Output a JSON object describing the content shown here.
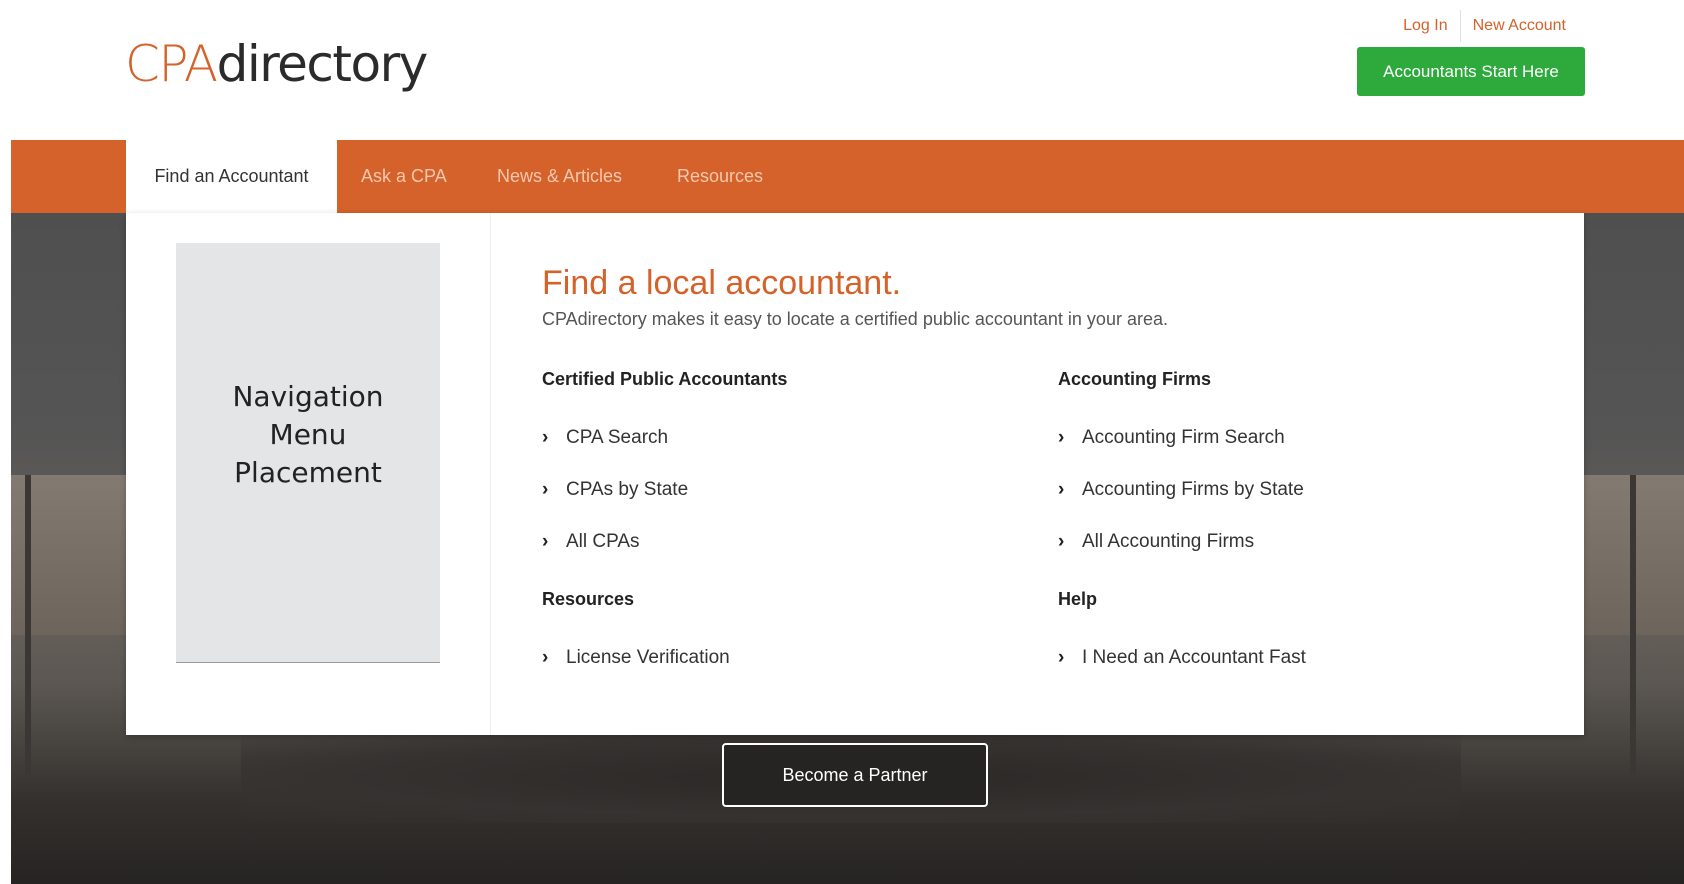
{
  "header": {
    "logo": {
      "part1": "CPA",
      "part2": "directory"
    },
    "login_label": "Log In",
    "new_account_label": "New Account",
    "cta_label": "Accountants Start Here"
  },
  "nav": {
    "tabs": [
      {
        "label": "Find an Accountant",
        "active": true
      },
      {
        "label": "Ask a CPA",
        "active": false
      },
      {
        "label": "News & Articles",
        "active": false
      },
      {
        "label": "Resources",
        "active": false
      }
    ]
  },
  "dropdown": {
    "placeholder_text": "Navigation Menu Placement",
    "title": "Find a local accountant.",
    "subtitle": "CPAdirectory makes it easy to locate a certified public accountant in your area.",
    "sections": [
      {
        "heading": "Certified Public Accountants",
        "links": [
          "CPA Search",
          "CPAs by State",
          "All CPAs"
        ]
      },
      {
        "heading": "Accounting Firms",
        "links": [
          "Accounting Firm Search",
          "Accounting Firms by State",
          "All Accounting Firms"
        ]
      },
      {
        "heading": "Resources",
        "links": [
          "License Verification"
        ]
      },
      {
        "heading": "Help",
        "links": [
          "I Need an Accountant Fast"
        ]
      }
    ]
  },
  "hero": {
    "partner_label": "Become a Partner"
  },
  "colors": {
    "brand_orange": "#d4622a",
    "cta_green": "#2eaa3d"
  }
}
